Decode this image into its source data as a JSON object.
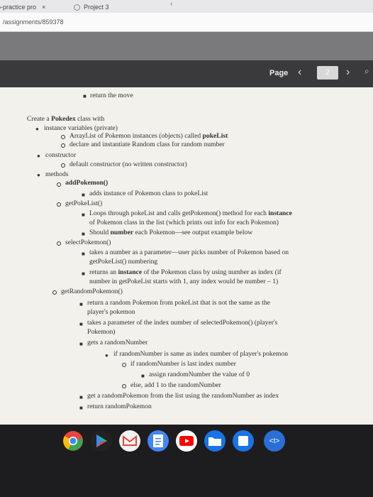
{
  "browser": {
    "tab1_title": "o-practice pro",
    "tab1_close": "×",
    "tab2_title": "Project 3",
    "tab_arrow": "‹",
    "url": "/assignments/859378"
  },
  "viewer": {
    "page_label": "Page",
    "prev": "‹",
    "page_number": "2",
    "next": "›",
    "zoom": "⌕"
  },
  "doc": {
    "line01": "return the move",
    "line02_a": "Create a ",
    "line02_b": "Pokedex",
    "line02_c": " class with",
    "line03": "instance variables (private)",
    "line04_a": "ArrayList of Pokemon instances (objects) called ",
    "line04_b": "pokeList",
    "line05": "declare and instantiate Random class for random number",
    "line06": "constructor",
    "line07": "default constructor (no written constructor)",
    "line08": "methods",
    "line09": "addPokemon()",
    "line10": "adds instance of Pokemon class to pokeList",
    "line11": "getPokeList()",
    "line12_a": "Loops through pokeList and calls getPokemon() method for each ",
    "line12_b": "instance",
    "line13": "of Pokemon class in the list (which prints out info for each Pokemon)",
    "line14_a": "Should ",
    "line14_b": "number",
    "line14_c": " each Pokemon—see output example below",
    "line15": "selectPokemon()",
    "line16": "takes a number as a parameter—user picks number of Pokemon based on",
    "line17": "getPokeList() numbering",
    "line18_a": "returns an ",
    "line18_b": "instance",
    "line18_c": " of the Pokemon class by using number as index (if",
    "line19": "number in getPokeList starts with 1, any index would be number – 1)",
    "line20": "getRandomPokemon()",
    "line21": "return a random Pokemon from pokeList that is not the same as the",
    "line22": "player's pokemon",
    "line23": "takes a parameter of the index number of selectedPokemon() (player's",
    "line24": "Pokemon)",
    "line25": "gets a randomNumber",
    "line26": "if randomNumber is same as index number of player's pokemon",
    "line27": "if randomNumber is last index number",
    "line28": "assign randomNumber the value of 0",
    "line29": "else, add 1 to the randomNumber",
    "line30": "get a randomPokemon from the list using the randomNumber as index",
    "line31": "return randomPokemon"
  },
  "taskbar": {
    "apps": [
      {
        "name": "chrome",
        "color": "#e8453c"
      },
      {
        "name": "play-store",
        "color": "#01875f"
      },
      {
        "name": "gmail",
        "color": "#f2f2f2"
      },
      {
        "name": "docs",
        "color": "#4285f4"
      },
      {
        "name": "youtube",
        "color": "#ff0000"
      },
      {
        "name": "files",
        "color": "#1a73e8"
      },
      {
        "name": "text-editor",
        "color": "#2a6fd6"
      }
    ],
    "text_editor_label": "<t>"
  }
}
